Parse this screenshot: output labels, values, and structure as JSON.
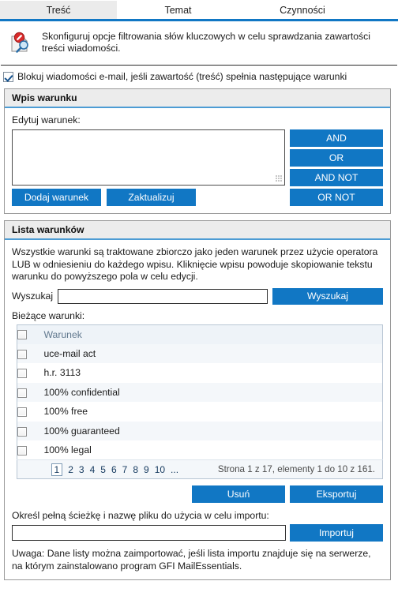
{
  "theme": {
    "accent": "#1177c4",
    "panel_header_bg": "#ececec",
    "grid_stripe": "#f4f7fa"
  },
  "tabs": [
    {
      "label": "Treść",
      "active": true
    },
    {
      "label": "Temat",
      "active": false
    },
    {
      "label": "Czynności",
      "active": false
    }
  ],
  "description": {
    "icon": "blocked-message-search-icon",
    "text": "Skonfiguruj opcje filtrowania słów kluczowych w celu sprawdzania zawartości treści wiadomości."
  },
  "block_checkbox": {
    "label": "Blokuj wiadomości e-mail, jeśli zawartość (treść) spełnia następujące warunki",
    "checked": true
  },
  "condition_entry": {
    "title": "Wpis warunku",
    "edit_label": "Edytuj warunek:",
    "textarea_value": "",
    "operators": [
      "AND",
      "OR",
      "AND NOT",
      "OR NOT"
    ],
    "add_label": "Dodaj warunek",
    "update_label": "Zaktualizuj"
  },
  "condition_list": {
    "title": "Lista warunków",
    "note": "Wszystkie warunki są traktowane zbiorczo jako jeden warunek przez użycie operatora LUB w odniesieniu do każdego wpisu. Kliknięcie wpisu powoduje skopiowanie tekstu warunku do powyższego pola w celu edycji.",
    "search_label": "Wyszukaj",
    "search_value": "",
    "search_button": "Wyszukaj",
    "current_label": "Bieżące warunki:",
    "column_header": "Warunek",
    "rows": [
      "uce-mail act",
      "h.r. 3113",
      "100% confidential",
      "100% free",
      "100% guaranteed",
      "100% legal"
    ],
    "pagination": {
      "pages": [
        "1",
        "2",
        "3",
        "4",
        "5",
        "6",
        "7",
        "8",
        "9",
        "10",
        "..."
      ],
      "current_page": "1",
      "status": "Strona 1 z 17, elementy 1 do 10 z 161."
    },
    "delete_label": "Usuń",
    "export_label": "Eksportuj",
    "import_label": "Określ pełną ścieżkę i nazwę pliku do użycia w celu importu:",
    "import_value": "",
    "import_button": "Importuj",
    "footnote": "Uwaga: Dane listy można zaimportować, jeśli lista importu znajduje się na serwerze, na którym zainstalowano program GFI MailEssentials."
  }
}
